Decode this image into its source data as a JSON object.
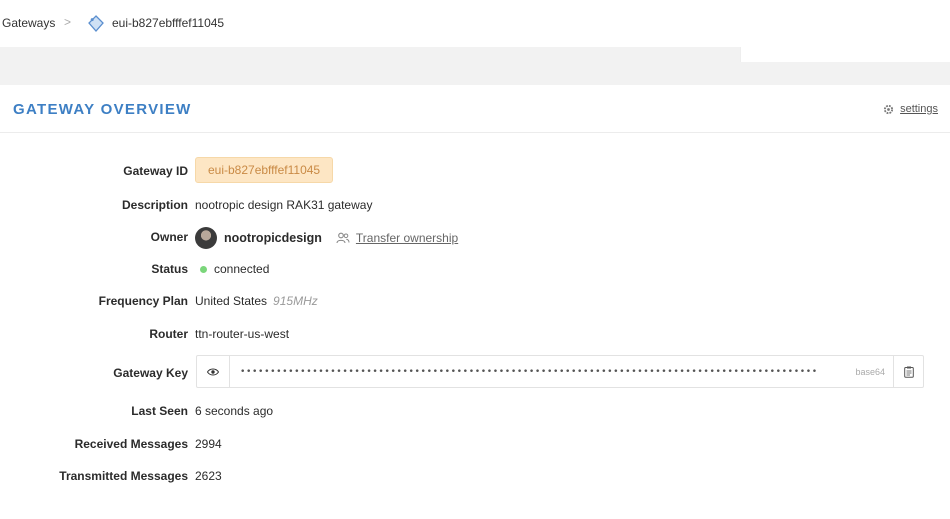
{
  "breadcrumb": {
    "root": "Gateways",
    "separator": ">",
    "current": "eui-b827ebfffef11045"
  },
  "overview": {
    "title": "GATEWAY OVERVIEW",
    "settings_label": "settings"
  },
  "fields": {
    "gateway_id": {
      "label": "Gateway ID",
      "value": "eui-b827ebfffef11045"
    },
    "description": {
      "label": "Description",
      "value": "nootropic design RAK31 gateway"
    },
    "owner": {
      "label": "Owner",
      "value": "nootropicdesign",
      "action": "Transfer ownership"
    },
    "status": {
      "label": "Status",
      "value": "connected",
      "color": "#7bd67b"
    },
    "frequency_plan": {
      "label": "Frequency Plan",
      "value": "United States",
      "sub": "915MHz"
    },
    "router": {
      "label": "Router",
      "value": "ttn-router-us-west"
    },
    "gateway_key": {
      "label": "Gateway Key",
      "masked": "••••••••••••••••••••••••••••••••••••••••••••••••••••••••••••••••••••••••••••••••••••••••••••••••",
      "format": "base64"
    },
    "last_seen": {
      "label": "Last Seen",
      "value": "6 seconds ago"
    },
    "received": {
      "label": "Received Messages",
      "value": "2994"
    },
    "transmitted": {
      "label": "Transmitted Messages",
      "value": "2623"
    }
  },
  "colors": {
    "title": "#3d7fc4",
    "badge_bg": "#fde6c4",
    "badge_text": "#c98a45"
  }
}
